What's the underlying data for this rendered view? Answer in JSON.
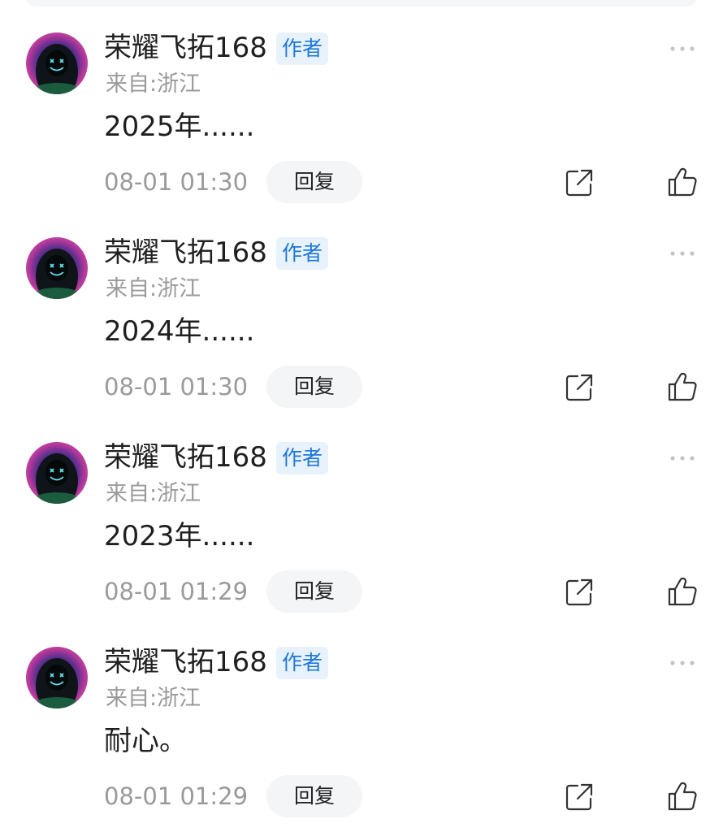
{
  "comments": [
    {
      "username": "荣耀飞拓168",
      "badge": "作者",
      "location": "来自:浙江",
      "content": "2025年......",
      "time": "08-01 01:30",
      "reply_label": "回复"
    },
    {
      "username": "荣耀飞拓168",
      "badge": "作者",
      "location": "来自:浙江",
      "content": "2024年......",
      "time": "08-01 01:30",
      "reply_label": "回复"
    },
    {
      "username": "荣耀飞拓168",
      "badge": "作者",
      "location": "来自:浙江",
      "content": "2023年......",
      "time": "08-01 01:29",
      "reply_label": "回复"
    },
    {
      "username": "荣耀飞拓168",
      "badge": "作者",
      "location": "来自:浙江",
      "content": "耐心。",
      "time": "08-01 01:29",
      "reply_label": "回复"
    }
  ],
  "icons": {
    "more": "more-dots-icon",
    "share": "share-icon",
    "like": "thumbs-up-icon",
    "avatar": "hooded-figure-avatar"
  },
  "colors": {
    "badge_text": "#1d78d6",
    "badge_bg": "#e8f2fd",
    "secondary_text": "#9a9a9a",
    "primary_text": "#1f1f1f",
    "reply_bg": "#f4f5f7"
  }
}
